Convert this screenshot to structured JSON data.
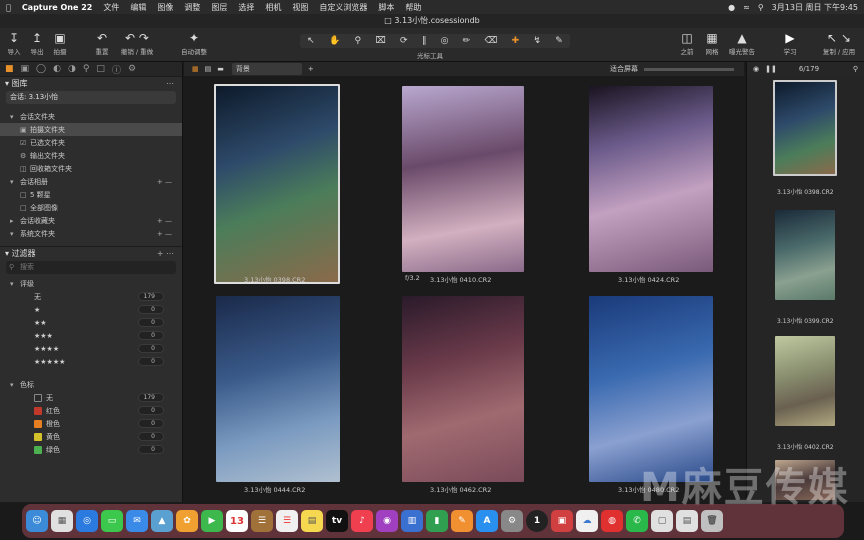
{
  "menubar": {
    "app": "Capture One 22",
    "items": [
      "文件",
      "编辑",
      "图像",
      "调整",
      "图层",
      "选择",
      "相机",
      "视图",
      "自定义浏览器",
      "脚本",
      "帮助"
    ],
    "datetime": "3月13日 周日 下午9:45"
  },
  "window": {
    "title": "3.13小怡.cosessiondb"
  },
  "toolbar": {
    "import": "导入",
    "export": "导出",
    "capture": "拍摄",
    "reset": "重置",
    "undo_redo": "撤销 / 重做",
    "auto_adjust": "自动调整",
    "cursor_tools": "光标工具",
    "before": "之前",
    "grid": "网格",
    "exposure_warning": "曝光警告",
    "learn": "学习",
    "copy_apply": "复制 / 应用"
  },
  "library": {
    "title": "图库",
    "session_select": "会话: 3.13小怡",
    "session_folders_header": "会话文件夹",
    "session_folders": [
      "拍摄文件夹",
      "已选文件夹",
      "输出文件夹",
      "回收箱文件夹"
    ],
    "session_albums_header": "会话相册",
    "session_albums": [
      "5 颗星",
      "全部图像"
    ],
    "session_favorites_header": "会话收藏夹",
    "system_folders_header": "系统文件夹"
  },
  "filters": {
    "title": "过滤器",
    "search_placeholder": "搜索",
    "rating_header": "评级",
    "ratings": [
      {
        "label": "无",
        "count": "179"
      },
      {
        "label": "★",
        "count": "0"
      },
      {
        "label": "★★",
        "count": "0"
      },
      {
        "label": "★★★",
        "count": "0"
      },
      {
        "label": "★★★★",
        "count": "0"
      },
      {
        "label": "★★★★★",
        "count": "0"
      }
    ],
    "color_header": "色标",
    "colors": [
      {
        "label": "无",
        "count": "179",
        "color": "#2a2a2a"
      },
      {
        "label": "红色",
        "count": "0",
        "color": "#c0392b"
      },
      {
        "label": "橙色",
        "count": "0",
        "color": "#e67e22"
      },
      {
        "label": "黄色",
        "count": "0",
        "color": "#d4c22a"
      },
      {
        "label": "绿色",
        "count": "0",
        "color": "#4caf50"
      }
    ]
  },
  "viewbar": {
    "layer": "背景",
    "fit": "适合屏幕",
    "counter": "6/179"
  },
  "browser": {
    "images": [
      {
        "name": "3.13小怡 0398.CR2",
        "info": ""
      },
      {
        "name": "3.13小怡 0410.CR2",
        "info": "f/3.2"
      },
      {
        "name": "3.13小怡 0424.CR2",
        "info": ""
      },
      {
        "name": "3.13小怡 0444.CR2",
        "info": ""
      },
      {
        "name": "3.13小怡 0462.CR2",
        "info": ""
      },
      {
        "name": "3.13小怡 0480.CR2",
        "info": ""
      }
    ]
  },
  "filmstrip": {
    "images": [
      "3.13小怡 0398.CR2",
      "3.13小怡 0399.CR2",
      "3.13小怡 0402.CR2",
      ""
    ]
  },
  "dock": {
    "calendar_day": "13"
  },
  "watermark": "M麻豆传媒"
}
